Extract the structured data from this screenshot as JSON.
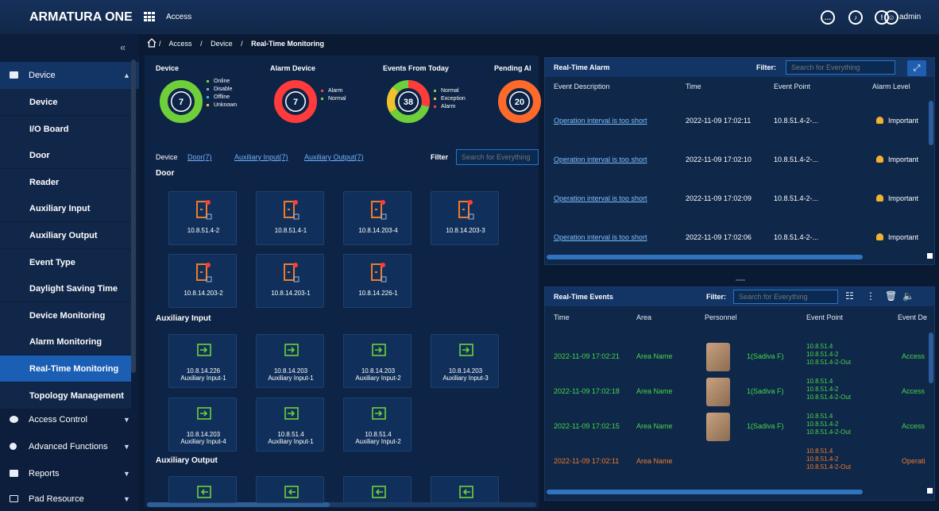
{
  "app": {
    "brand": "ARMATURA ONE",
    "module": "Access",
    "user": "admin"
  },
  "header_icons": [
    {
      "name": "chat-icon"
    },
    {
      "name": "bell-icon"
    },
    {
      "name": "alarm-icon"
    },
    {
      "name": "user-icon"
    }
  ],
  "breadcrumb": {
    "items": [
      "Access",
      "Device",
      "Real-Time Monitoring"
    ],
    "sep": "/"
  },
  "sidebar": {
    "sections": [
      {
        "label": "Device",
        "open": true
      },
      {
        "label": "Access Control"
      },
      {
        "label": "Advanced Functions"
      },
      {
        "label": "Reports"
      },
      {
        "label": "Pad Resource"
      }
    ],
    "items": [
      "Device",
      "I/O Board",
      "Door",
      "Reader",
      "Auxiliary Input",
      "Auxiliary Output",
      "Event Type",
      "Daylight Saving Time",
      "Device Monitoring",
      "Alarm Monitoring",
      "Real-Time Monitoring",
      "Topology Management"
    ],
    "active": "Real-Time Monitoring"
  },
  "stats": [
    {
      "title": "Device",
      "value": "7",
      "legend": [
        {
          "label": "Online",
          "color": "#7ccf3c"
        },
        {
          "label": "Disable",
          "color": "#9aa3ad"
        },
        {
          "label": "Offline",
          "color": "#3fb4d9"
        },
        {
          "label": "Unknown",
          "color": "#f2c12e"
        }
      ],
      "ring": "#6fcf3a"
    },
    {
      "title": "Alarm Device",
      "value": "7",
      "legend": [
        {
          "label": "Alarm",
          "color": "#ff3b3b"
        },
        {
          "label": "Normal",
          "color": "#7ccf3c"
        }
      ],
      "ring": "#ff3b3b"
    },
    {
      "title": "Events From Today",
      "value": "38",
      "legend": [
        {
          "label": "Normal",
          "color": "#7ccf3c"
        },
        {
          "label": "Exception",
          "color": "#f2c12e"
        },
        {
          "label": "Alarm",
          "color": "#ff3b3b"
        }
      ],
      "ring": "#6fcf3a"
    },
    {
      "title": "Pending Al",
      "value": "20",
      "ring": "#ff6a2b"
    }
  ],
  "device_tabs": {
    "device": "Device",
    "door": "Door(7)",
    "aux_in": "Auxiliary Input(7)",
    "aux_out": "Auxiliary Output(7)",
    "filter_label": "Filter",
    "filter_placeholder": "Search for Everything"
  },
  "sections": {
    "door": "Door",
    "aux_in": "Auxiliary Input",
    "aux_out": "Auxiliary Output"
  },
  "doors": [
    "10.8.51.4-2",
    "10.8.51.4-1",
    "10.8.14.203-4",
    "10.8.14.203-3",
    "10.8.14.203-2",
    "10.8.14.203-1",
    "10.8.14.226-1"
  ],
  "aux_inputs": [
    [
      "10.8.14.226",
      "Auxiliary Input-1"
    ],
    [
      "10.8.14.203",
      "Auxiliary Input-1"
    ],
    [
      "10.8.14.203",
      "Auxiliary Input-2"
    ],
    [
      "10.8.14.203",
      "Auxiliary Input-3"
    ],
    [
      "10.8.14.203",
      "Auxiliary Input-4"
    ],
    [
      "10.8.51.4",
      "Auxiliary Input-1"
    ],
    [
      "10.8.51.4",
      "Auxiliary Input-2"
    ]
  ],
  "alarm_panel": {
    "title": "Real-Time Alarm",
    "filter_label": "Filter:",
    "placeholder": "Search for Everything",
    "columns": [
      "Event Description",
      "Time",
      "Event Point",
      "Alarm Level"
    ],
    "rows": [
      [
        "Operation interval is too short",
        "2022-11-09 17:02:11",
        "10.8.51.4-2-...",
        "Important"
      ],
      [
        "Operation interval is too short",
        "2022-11-09 17:02:10",
        "10.8.51.4-2-...",
        "Important"
      ],
      [
        "Operation interval is too short",
        "2022-11-09 17:02:09",
        "10.8.51.4-2-...",
        "Important"
      ],
      [
        "Operation interval is too short",
        "2022-11-09 17:02:06",
        "10.8.51.4-2-...",
        "Important"
      ]
    ]
  },
  "events_panel": {
    "title": "Real-Time Events",
    "filter_label": "Filter:",
    "placeholder": "Search for Everything",
    "columns": [
      "Time",
      "Area",
      "Personnel",
      "Event Point",
      "Event De"
    ],
    "rows": [
      {
        "time": "2022-11-09 17:02:21",
        "area": "Area Name",
        "person": "1(Sadiva F)",
        "point": [
          "10.8.51.4",
          "10.8.51.4-2",
          "10.8.51.4-2-Out"
        ],
        "desc": "Access",
        "color": "green"
      },
      {
        "time": "2022-11-09 17:02:18",
        "area": "Area Name",
        "person": "1(Sadiva F)",
        "point": [
          "10.8.51.4",
          "10.8.51.4-2",
          "10.8.51.4-2-Out"
        ],
        "desc": "Access",
        "color": "green"
      },
      {
        "time": "2022-11-09 17:02:15",
        "area": "Area Name",
        "person": "1(Sadiva F)",
        "point": [
          "10.8.51.4",
          "10.8.51.4-2",
          "10.8.51.4-2-Out"
        ],
        "desc": "Access",
        "color": "green"
      },
      {
        "time": "2022-11-09 17:02:11",
        "area": "Area Name",
        "person": "",
        "point": [
          "10.8.51.4",
          "10.8.51.4-2",
          "10.8.51.4-2-Out"
        ],
        "desc": "Operati",
        "color": "orange"
      }
    ]
  }
}
